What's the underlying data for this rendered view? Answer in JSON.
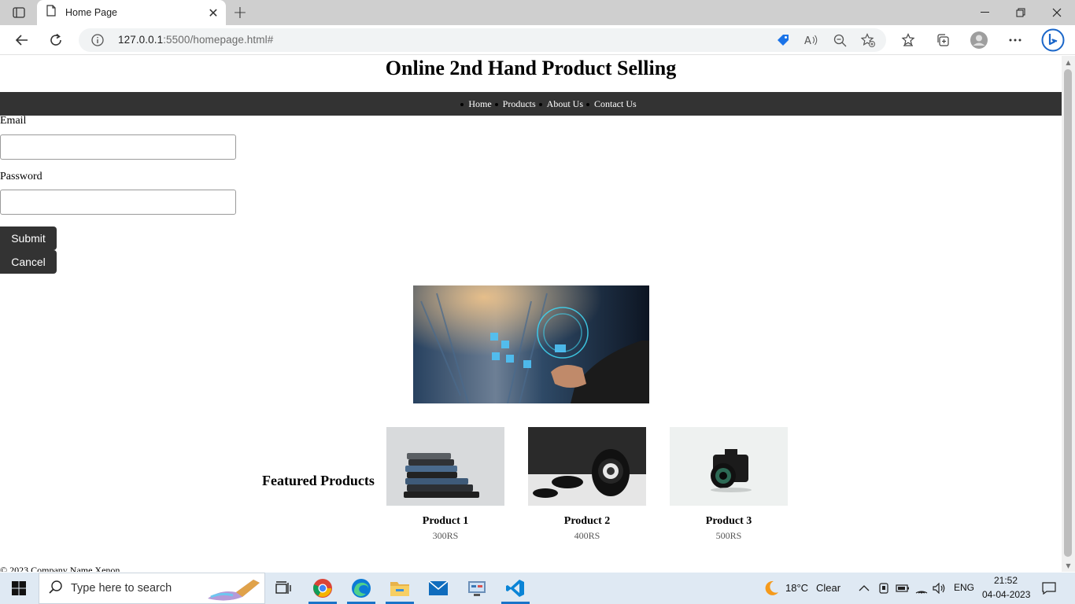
{
  "browser": {
    "tab_title": "Home Page",
    "url_host": "127.0.0.1",
    "url_path": ":5500/homepage.html#"
  },
  "page": {
    "title": "Online 2nd Hand Product Selling",
    "nav": [
      "Home",
      "Products",
      "About Us",
      "Contact Us"
    ],
    "form": {
      "email_label": "Email",
      "email_value": "",
      "password_label": "Password",
      "password_value": "",
      "submit_label": "Submit",
      "cancel_label": "Cancel"
    },
    "featured_heading": "Featured Products",
    "products": [
      {
        "name": "Product 1",
        "price": "300RS"
      },
      {
        "name": "Product 2",
        "price": "400RS"
      },
      {
        "name": "Product 3",
        "price": "500RS"
      }
    ],
    "footer": "© 2023 Company Name Xenon"
  },
  "taskbar": {
    "search_placeholder": "Type here to search",
    "weather_temp": "18°C",
    "weather_desc": "Clear",
    "language": "ENG",
    "time": "21:52",
    "date": "04-04-2023"
  }
}
